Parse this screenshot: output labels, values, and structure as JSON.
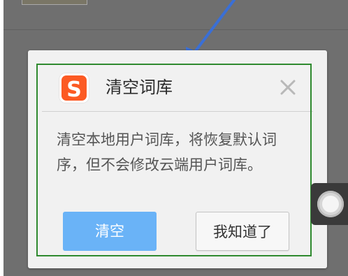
{
  "dialog": {
    "title": "清空词库",
    "message": "清空本地用户词库，将恢复默认词序，但不会修改云端用户词库。",
    "confirm_label": "清空",
    "dismiss_label": "我知道了",
    "logo_letter": "S"
  },
  "icons": {
    "app_logo": "sogou-logo-icon",
    "close": "close-icon",
    "floating": "floating-assistant-icon"
  },
  "colors": {
    "brand": "#fc5a23",
    "primary_button": "#6ab3f7",
    "annotation_box": "#2f8a2f",
    "annotation_arrow": "#3a6fd6"
  }
}
